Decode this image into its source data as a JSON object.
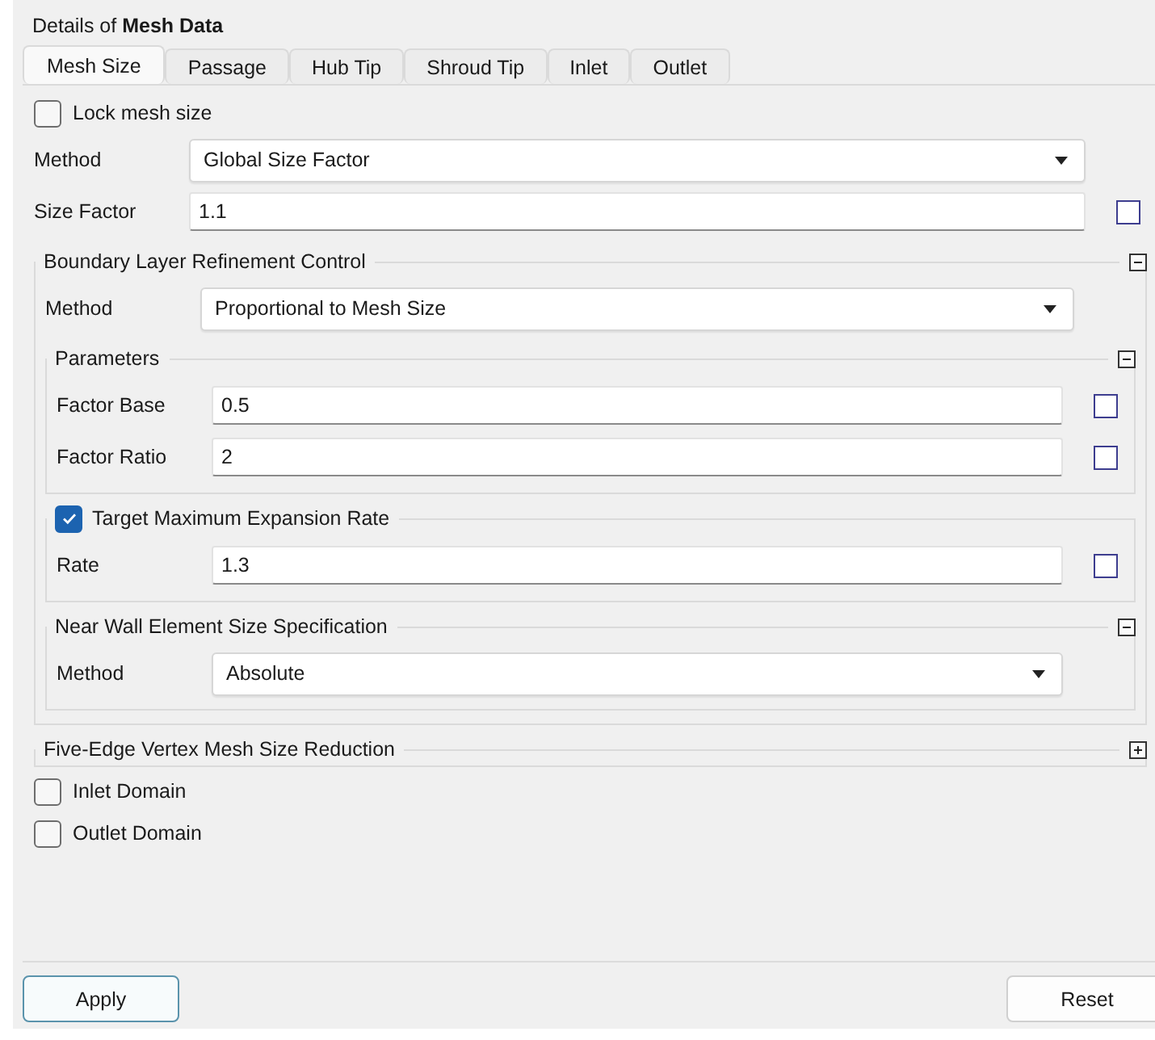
{
  "header": {
    "title": "Details of **Mesh Data**"
  },
  "tabs": [
    {
      "label": "Mesh Size",
      "selected": true
    },
    {
      "label": "Passage",
      "selected": false
    },
    {
      "label": "Hub Tip",
      "selected": false
    },
    {
      "label": "Shroud Tip",
      "selected": false
    },
    {
      "label": "Inlet",
      "selected": false
    },
    {
      "label": "Outlet",
      "selected": false
    }
  ],
  "content": [
    {
      "kind": "checkbox",
      "label": "Lock mesh size",
      "checked": false
    },
    {
      "kind": "select",
      "label": "Method",
      "value": "Global Size Factor"
    },
    {
      "kind": "field",
      "label": "Size Factor",
      "value": "1.1",
      "checked": false
    },
    {
      "kind": "group",
      "title": "Boundary Layer Refinement Control",
      "expanded": true,
      "children": [
        {
          "kind": "select",
          "label": "Method",
          "value": "Proportional to Mesh Size"
        },
        {
          "kind": "group",
          "title": "Parameters",
          "expanded": true,
          "children": [
            {
              "kind": "field",
              "label": "Factor Base",
              "value": "0.5",
              "checked": false
            },
            {
              "kind": "field",
              "label": "Factor Ratio",
              "value": "2",
              "checked": false
            }
          ]
        },
        {
          "kind": "checkgroup",
          "title": "Target Maximum Expansion Rate",
          "checked": true,
          "children": [
            {
              "kind": "field",
              "label": "Rate",
              "value": "1.3",
              "checked": false
            }
          ]
        },
        {
          "kind": "group",
          "title": "Near Wall Element Size Specification",
          "expanded": true,
          "children": [
            {
              "kind": "select",
              "label": "Method",
              "value": "Absolute"
            }
          ]
        }
      ]
    },
    {
      "kind": "group",
      "title": "Five-Edge Vertex Mesh Size Reduction",
      "expanded": false
    },
    {
      "kind": "checkbox",
      "label": "Inlet Domain",
      "checked": false
    },
    {
      "kind": "checkbox",
      "label": "Outlet Domain",
      "checked": false
    }
  ],
  "buttons": [
    {
      "label": "Apply",
      "default": true
    },
    {
      "label": "Reset",
      "default": false
    }
  ]
}
